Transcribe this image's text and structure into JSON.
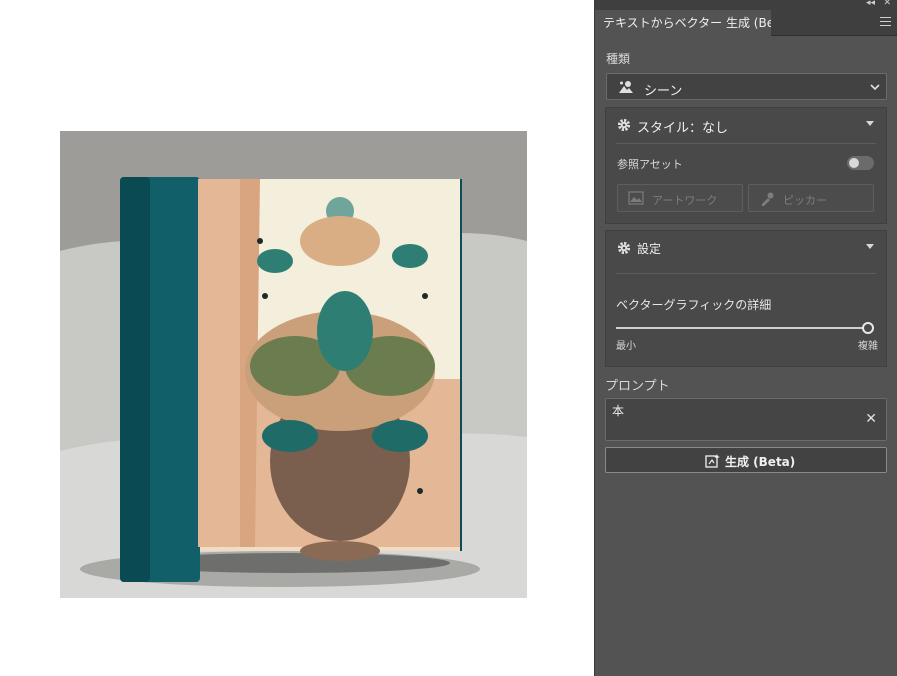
{
  "canvas": {
    "artwork_alt": "ベクター生成された本のイラスト"
  },
  "panel": {
    "tab_title": "テキストからベクター 生成 (Beta)",
    "type_label": "種類",
    "type_dropdown": {
      "selected": "シーン",
      "icon": "scene-icon"
    },
    "style_section": {
      "title": "スタイル：なし",
      "reference_label": "参照アセット",
      "reference_toggle_on": false,
      "artwork_button": "アートワーク",
      "picker_button": "ピッカー"
    },
    "settings_section": {
      "title": "設定",
      "detail_label": "ベクターグラフィックの詳細",
      "detail_value": 1.0,
      "min_label": "最小",
      "max_label": "複雑"
    },
    "prompt_label": "プロンプト",
    "prompt_value": "本",
    "generate_button": "生成 (Beta)"
  },
  "colors": {
    "panel_bg": "#535353",
    "teal": "#0f5a63"
  }
}
